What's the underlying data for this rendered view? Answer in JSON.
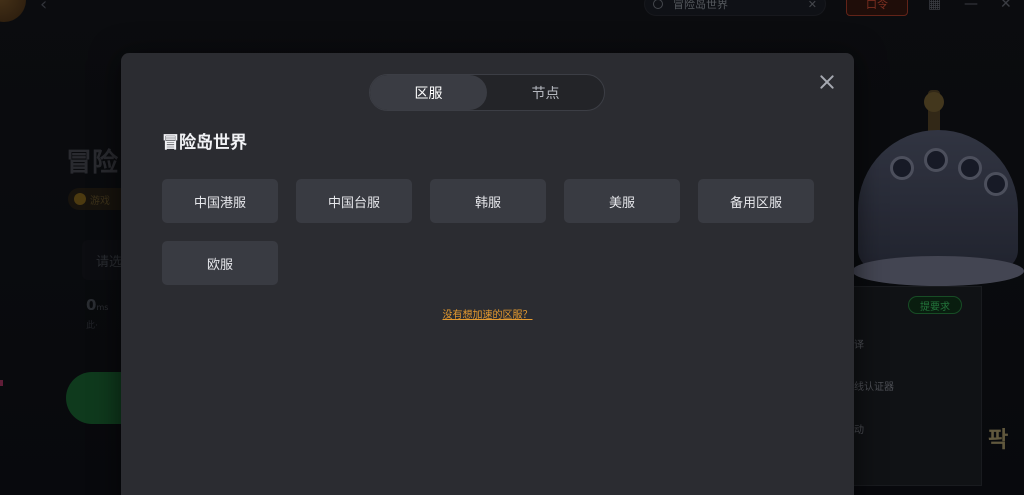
{
  "background": {
    "search_text": "冒险岛世界",
    "code_button": "口令",
    "game_title_partial": "冒险",
    "badge_text": "游戏",
    "select_placeholder": "请选",
    "latency_value": "0",
    "latency_unit": "ms",
    "latency_sub": "此·",
    "feedback_button": "提要求",
    "side_items": [
      "译",
      "线认证器",
      "动"
    ],
    "korean_text": "팍"
  },
  "modal": {
    "tabs": [
      {
        "label": "区服",
        "active": true
      },
      {
        "label": "节点",
        "active": false
      }
    ],
    "game_title": "冒险岛世界",
    "servers": [
      "中国港服",
      "中国台服",
      "韩服",
      "美服",
      "备用区服",
      "欧服"
    ],
    "request_link": "没有想加速的区服？"
  },
  "colors": {
    "modal_bg": "#2b2c31",
    "button_bg": "#393b42",
    "link": "#e59a2f",
    "feedback_green": "#3fd06a",
    "code_red": "#e0553b"
  }
}
